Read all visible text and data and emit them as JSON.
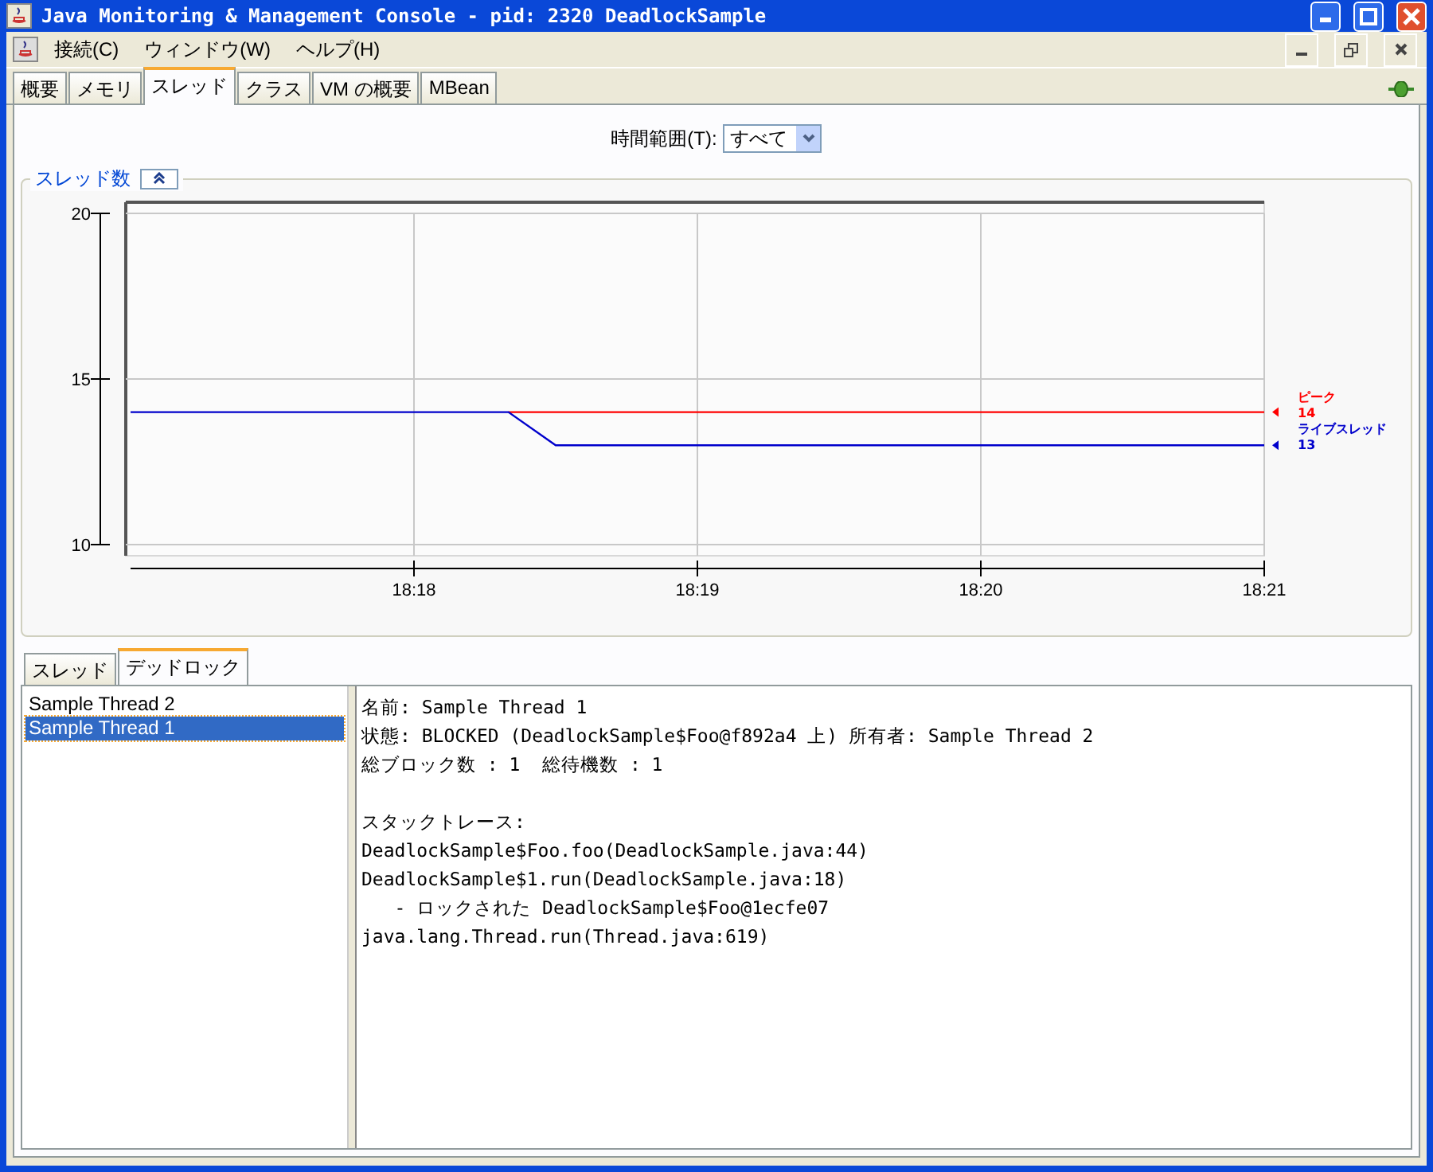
{
  "window": {
    "title": "Java Monitoring & Management Console - pid: 2320 DeadlockSample"
  },
  "menu": [
    {
      "label": "接続(C)"
    },
    {
      "label": "ウィンドウ(W)"
    },
    {
      "label": "ヘルプ(H)"
    }
  ],
  "tabs": [
    {
      "label": "概要",
      "selected": false
    },
    {
      "label": "メモリ",
      "selected": false
    },
    {
      "label": "スレッド",
      "selected": true
    },
    {
      "label": "クラス",
      "selected": false
    },
    {
      "label": "VM の概要",
      "selected": false
    },
    {
      "label": "MBean",
      "selected": false
    }
  ],
  "time_range": {
    "label": "時間範囲(T):",
    "value": "すべて"
  },
  "thread_panel": {
    "title": "スレッド数",
    "chart_data": {
      "type": "line",
      "categories": [
        null,
        null,
        null,
        null,
        null,
        null,
        "18:18",
        null,
        null,
        null,
        null,
        null,
        "18:19",
        null,
        null,
        null,
        null,
        null,
        "18:20",
        null,
        null,
        null,
        null,
        null,
        "18:21"
      ],
      "ylim": [
        10,
        20
      ],
      "grid": true,
      "yticks": [
        10,
        15,
        20
      ],
      "series": [
        {
          "name": "ピーク",
          "color": "#ff0000",
          "values": [
            null,
            null,
            null,
            null,
            null,
            null,
            null,
            null,
            14,
            14,
            14,
            14,
            14,
            14,
            14,
            14,
            14,
            14,
            14,
            14,
            14,
            14,
            14,
            14,
            14
          ]
        },
        {
          "name": "ライブスレッド",
          "color": "#0000cc",
          "values": [
            14,
            14,
            14,
            14,
            14,
            14,
            14,
            14,
            14,
            13,
            13,
            13,
            13,
            13,
            13,
            13,
            13,
            13,
            13,
            13,
            13,
            13,
            13,
            13,
            13
          ]
        }
      ]
    },
    "legend_values": [
      "14",
      "13"
    ]
  },
  "lower_tabs": [
    {
      "label": "スレッド",
      "selected": false
    },
    {
      "label": "デッドロック",
      "selected": true
    }
  ],
  "threads": [
    {
      "name": "Sample Thread 2",
      "selected": false
    },
    {
      "name": "Sample Thread 1",
      "selected": true
    }
  ],
  "details": [
    "名前: Sample Thread 1",
    "状態: BLOCKED (DeadlockSample$Foo@f892a4 上) 所有者: Sample Thread 2",
    "総ブロック数 : 1  総待機数 : 1"
  ],
  "stack_title": "スタックトレース:",
  "stack": [
    "DeadlockSample$Foo.foo(DeadlockSample.java:44)",
    "DeadlockSample$1.run(DeadlockSample.java:18)",
    "   - ロックされた DeadlockSample$Foo@1ecfe07",
    "java.lang.Thread.run(Thread.java:619)"
  ]
}
